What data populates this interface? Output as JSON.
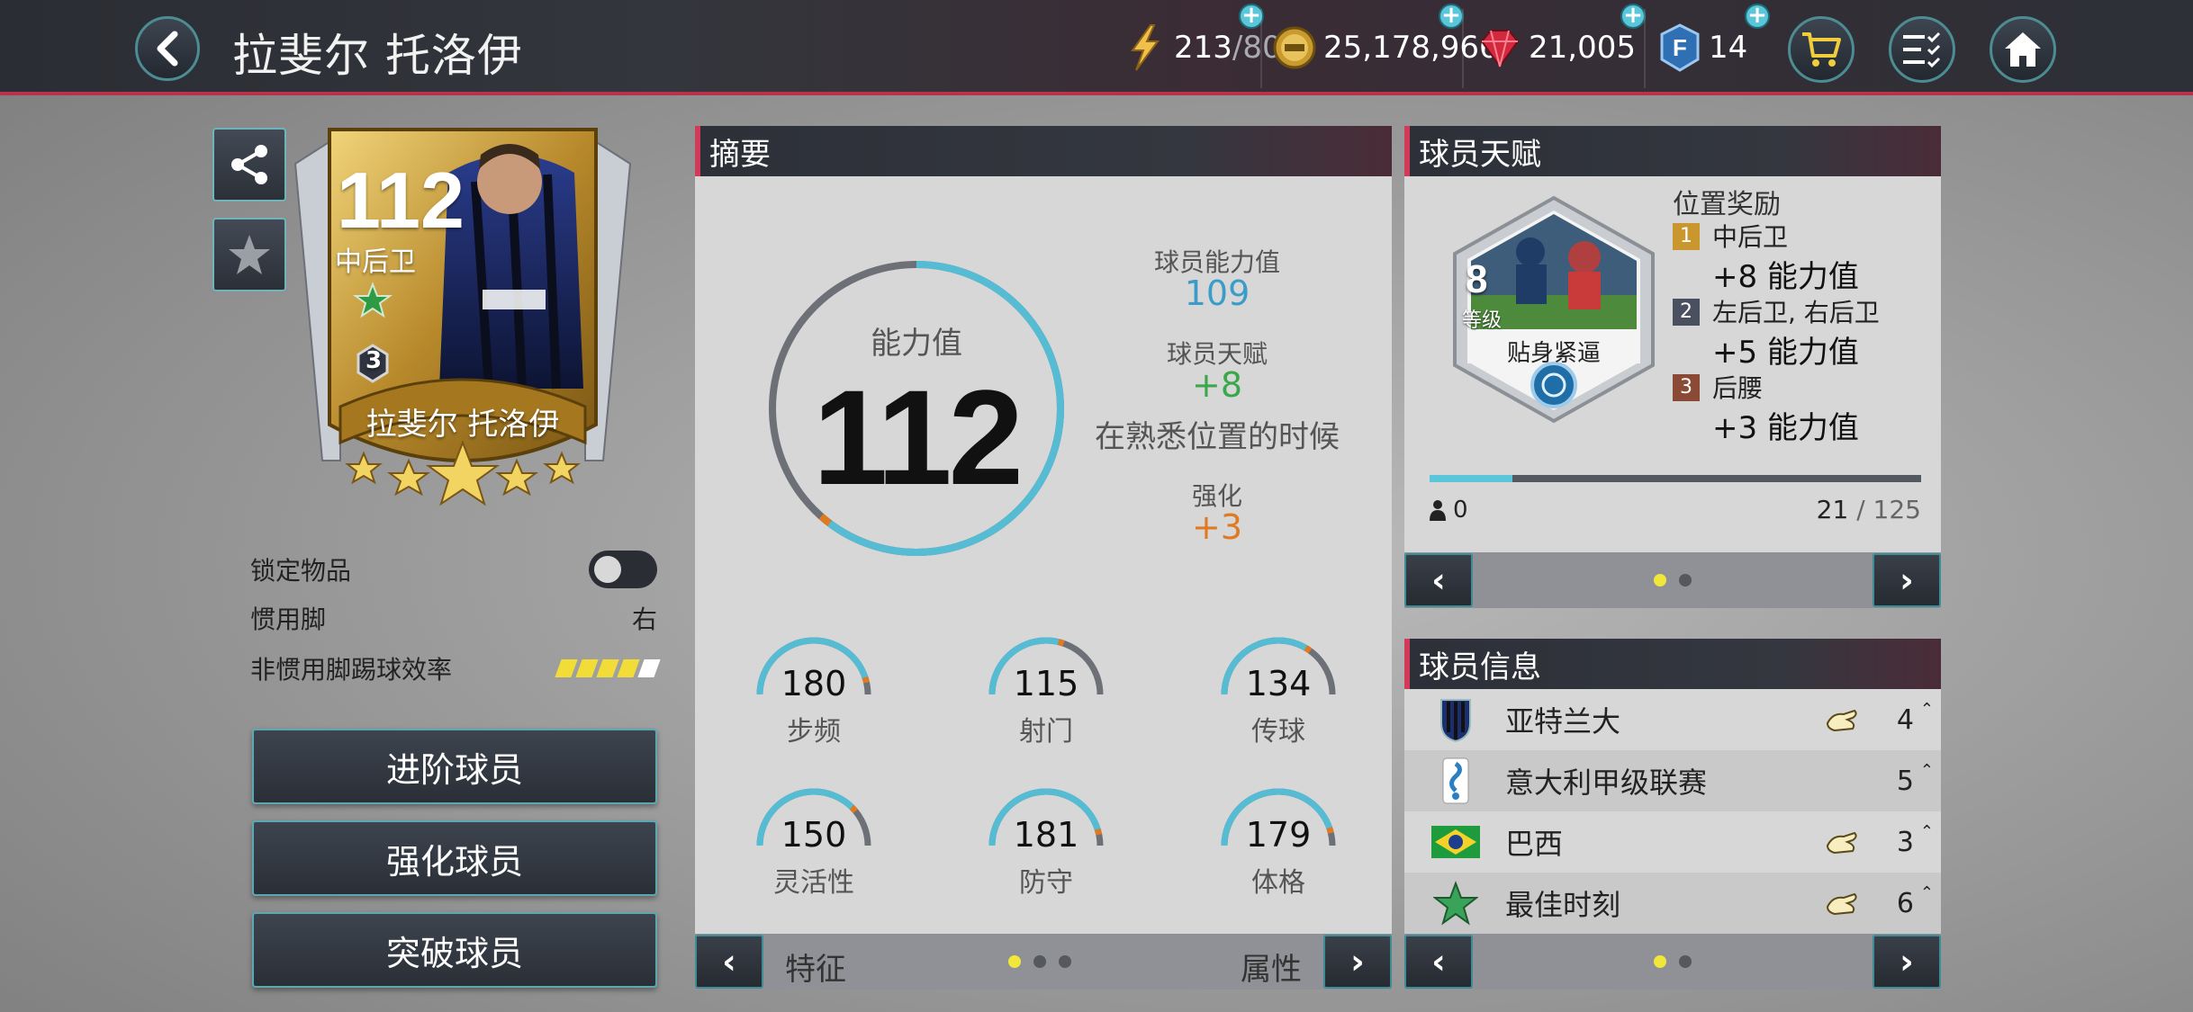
{
  "header": {
    "title": "拉斐尔 托洛伊",
    "energy": "213",
    "energy_max": "/80",
    "coins": "25,178,966",
    "gems": "21,005",
    "fifa_points": "14",
    "plus": "+"
  },
  "card": {
    "rating": "112",
    "position": "中后卫",
    "rank": "3",
    "name": "拉斐尔 托洛伊"
  },
  "props": {
    "lock_label": "锁定物品",
    "foot_label": "惯用脚",
    "foot_value": "右",
    "weak_foot_label": "非惯用脚踢球效率",
    "weak_foot_filled": 4,
    "weak_foot_total": 5
  },
  "actions": {
    "advance": "进阶球员",
    "enhance": "强化球员",
    "breakthrough": "突破球员"
  },
  "summary": {
    "title": "摘要",
    "ovr_label": "能力值",
    "ovr_value": "112",
    "base_label": "球员能力值",
    "base_value": "109",
    "talent_label": "球员天赋",
    "talent_value": "+8",
    "talent_note": "在熟悉位置的时候",
    "boost_label": "强化",
    "boost_value": "+3",
    "stats": [
      {
        "label": "步频",
        "value": "180"
      },
      {
        "label": "射门",
        "value": "115"
      },
      {
        "label": "传球",
        "value": "134"
      },
      {
        "label": "灵活性",
        "value": "150"
      },
      {
        "label": "防守",
        "value": "181"
      },
      {
        "label": "体格",
        "value": "179"
      }
    ],
    "footer_left": "特征",
    "footer_right": "属性"
  },
  "talent": {
    "title": "球员天赋",
    "skill_level": "8",
    "skill_level_label": "等级",
    "skill_name": "贴身紧逼",
    "reward_title": "位置奖励",
    "rewards": [
      {
        "rank": "1",
        "position": "中后卫",
        "bonus": "+8 能力值"
      },
      {
        "rank": "2",
        "position": "左后卫, 右后卫",
        "bonus": "+5 能力值"
      },
      {
        "rank": "3",
        "position": "后腰",
        "bonus": "+3 能力值"
      }
    ],
    "skill_points": "0",
    "progress_current": "21",
    "progress_sep": " / ",
    "progress_total": "125"
  },
  "info": {
    "title": "球员信息",
    "rows": [
      {
        "name": "亚特兰大",
        "level": "4"
      },
      {
        "name": "意大利甲级联赛",
        "level": "5"
      },
      {
        "name": "巴西",
        "level": "3"
      },
      {
        "name": "最佳时刻",
        "level": "6"
      }
    ]
  },
  "colors": {
    "accent": "#d23a5a",
    "teal": "#5bc6da",
    "green": "#3aa84a",
    "orange": "#e07a22",
    "blue_value": "#3a9cc8"
  }
}
